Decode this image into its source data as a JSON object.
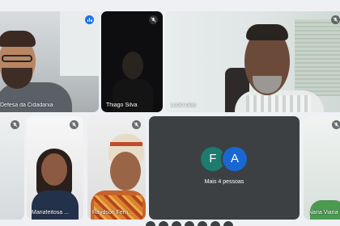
{
  "participants": {
    "p1": {
      "name": "Defesa da Cidadania",
      "mic": "speaking-indicator"
    },
    "p2": {
      "name": "Thiago Silva",
      "mic": "mic-muted-icon"
    },
    "p3": {
      "name": "Lucio Dias",
      "mic": "mic-muted-icon"
    },
    "p4": {
      "name": "",
      "mic": "mic-muted-icon"
    },
    "p5": {
      "name": "Mariafeitosa ...",
      "mic": "mic-muted-icon"
    },
    "p6": {
      "name": "Raydson Fern...",
      "mic": "mic-muted-icon"
    },
    "p8": {
      "name": "Naria Viana",
      "mic": "mic-muted-icon"
    }
  },
  "more_tile": {
    "label": "Mais 4 pessoas",
    "avatars": [
      {
        "letter": "F",
        "color": "#1e7b6f"
      },
      {
        "letter": "A",
        "color": "#1967d2"
      }
    ]
  },
  "colors": {
    "tile_dark": "#3c4043",
    "speaking": "#1a73e8",
    "background": "#eef0f3"
  }
}
